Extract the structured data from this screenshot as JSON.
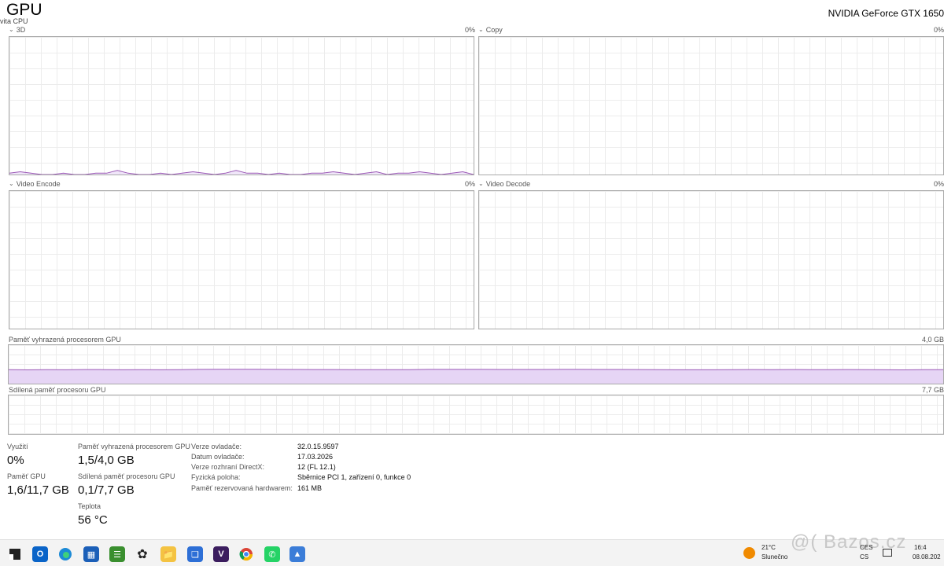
{
  "header": {
    "title": "GPU",
    "subtitle": "vita CPU",
    "device_name": "NVIDIA GeForce GTX 1650"
  },
  "graphs": {
    "g3d": {
      "label": "3D",
      "percent": "0%"
    },
    "copy": {
      "label": "Copy",
      "percent": "0%"
    },
    "encode": {
      "label": "Video Encode",
      "percent": "0%"
    },
    "decode": {
      "label": "Video Decode",
      "percent": "0%"
    },
    "dedicated": {
      "label": "Paměť vyhrazená procesorem GPU",
      "max": "4,0 GB"
    },
    "shared": {
      "label": "Sdílená paměť procesoru GPU",
      "max": "7,7 GB"
    }
  },
  "chart_data": [
    {
      "type": "line",
      "name": "3D",
      "values": [
        1,
        2,
        1,
        0,
        0,
        1,
        0,
        0,
        1,
        1,
        3,
        1,
        0,
        0,
        1,
        0,
        1,
        2,
        1,
        0,
        1,
        3,
        1,
        1,
        0,
        1,
        0,
        0,
        1,
        1,
        2,
        1,
        0,
        1,
        2,
        0,
        1,
        1,
        2,
        1,
        0,
        1,
        2,
        0
      ],
      "ylim": [
        0,
        100
      ]
    },
    {
      "type": "area",
      "name": "Paměť vyhrazená procesorem GPU",
      "values": [
        1.45,
        1.43,
        1.45,
        1.44,
        1.46,
        1.45,
        1.44,
        1.45,
        1.44,
        1.45,
        1.48,
        1.49,
        1.49,
        1.49,
        1.48,
        1.47,
        1.46,
        1.46,
        1.45,
        1.45,
        1.45,
        1.45,
        1.48,
        1.48,
        1.48,
        1.48,
        1.47,
        1.47,
        1.47,
        1.48,
        1.48,
        1.47,
        1.47,
        1.46,
        1.45,
        1.44,
        1.44,
        1.44,
        1.45,
        1.46,
        1.45,
        1.46,
        1.45,
        1.45,
        1.46,
        1.45,
        1.44,
        1.43,
        1.45,
        1.45
      ],
      "ylim": [
        0,
        4.0
      ]
    }
  ],
  "stats": {
    "usage_label": "Využití",
    "usage_value": "0%",
    "gpu_mem_label": "Paměť GPU",
    "gpu_mem_value": "1,6/11,7 GB",
    "dedicated_label": "Paměť vyhrazená procesorem GPU",
    "dedicated_value": "1,5/4,0 GB",
    "shared_label": "Sdílená paměť procesoru GPU",
    "shared_value": "0,1/7,7 GB",
    "temp_label": "Teplota",
    "temp_value": "56 °C"
  },
  "info": {
    "driver_version_label": "Verze ovladače:",
    "driver_version_value": "32.0.15.9597",
    "driver_date_label": "Datum ovladače:",
    "driver_date_value": "17.03.2026",
    "directx_label": "Verze rozhraní DirectX:",
    "directx_value": "12 (FL 12.1)",
    "location_label": "Fyzická poloha:",
    "location_value": "Sběrnice PCI 1, zařízení 0, funkce 0",
    "hw_reserved_label": "Paměť rezervovaná hardwarem:",
    "hw_reserved_value": "161 MB"
  },
  "taskbar": {
    "weather_temp": "21°C",
    "weather_desc": "Slunečno",
    "lang_top": "CES",
    "lang_bottom": "CS",
    "time": "16:4",
    "date": "08.08.202",
    "watermark": "@( Bazos.cz",
    "icons": [
      "windows-start-icon",
      "outlook-icon",
      "edge-icon",
      "store-icon",
      "app-stack-icon",
      "chatgpt-icon",
      "explorer-icon",
      "snip-icon",
      "v-app-icon",
      "chrome-icon",
      "whatsapp-icon",
      "photos-icon"
    ]
  },
  "colors": {
    "graph_line": "#9b59b6",
    "graph_fill": "#e6d5f5",
    "graph_border": "#a9a9a9"
  }
}
